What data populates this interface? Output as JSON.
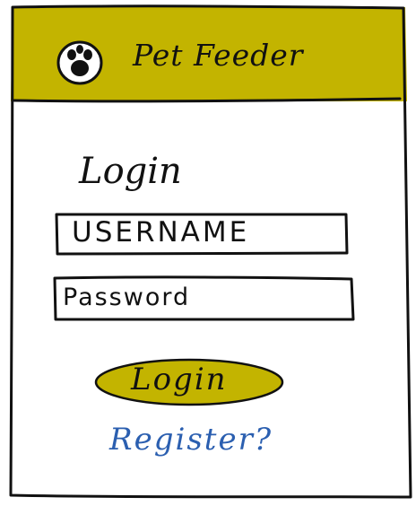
{
  "colors": {
    "header": "#c3b400",
    "button": "#c3b400",
    "link": "#2b5fb0",
    "ink": "#111111"
  },
  "header": {
    "logo_icon": "paw-icon",
    "title": "Pet Feeder"
  },
  "login_form": {
    "heading": "Login",
    "username_text": "USERNAME",
    "password_text": "Password",
    "submit_label": "Login",
    "register_link": "Register?"
  }
}
